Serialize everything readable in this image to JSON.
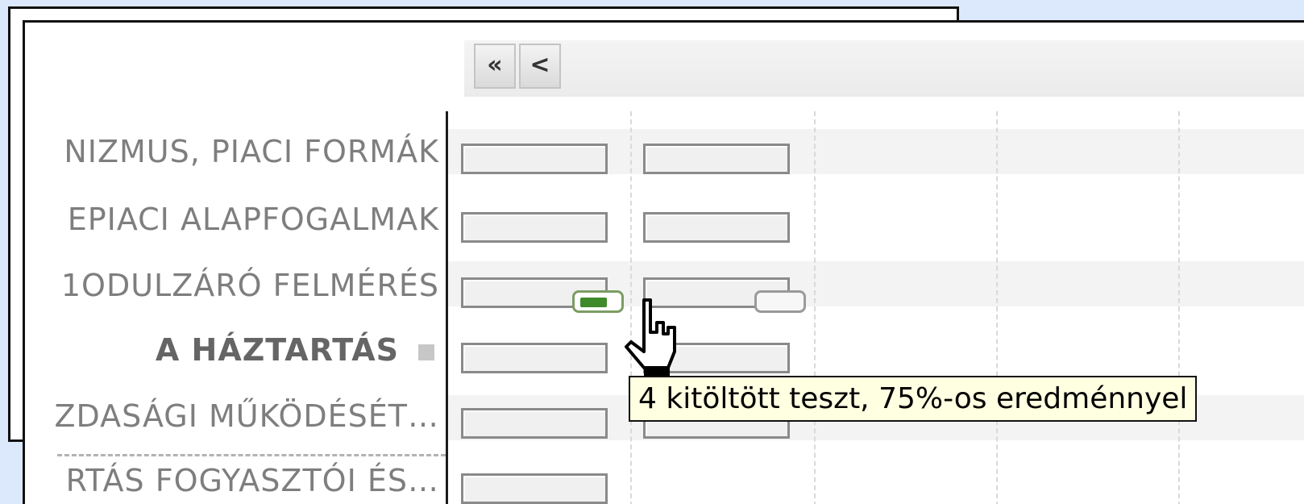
{
  "toolbar": {
    "first_label": "«",
    "prev_label": "<"
  },
  "rows": [
    {
      "label": "NIZMUS, PIACI FORMÁK"
    },
    {
      "label": "EPIACI ALAPFOGALMAK"
    },
    {
      "label": "1ODULZÁRÓ FELMÉRÉS"
    },
    {
      "label": "A HÁZTARTÁS",
      "section": true
    },
    {
      "label": "ZDASÁGI MŰKÖDÉSÉT…"
    },
    {
      "label": "RTÁS FOGYASZTÓI ÉS…"
    }
  ],
  "progress": {
    "first_column_value": 0.75,
    "second_column_value": 0.0
  },
  "tooltip": {
    "text": "4 kitöltött teszt, 75%-os eredménnyel"
  },
  "colors": {
    "progress_fill": "#3f8a2a",
    "tooltip_bg": "#ffffe1",
    "desktop_bg": "#dce8fb"
  },
  "icons": {
    "first": "double-chevron-left-icon",
    "prev": "chevron-left-icon",
    "cursor": "hand-pointer-icon"
  }
}
